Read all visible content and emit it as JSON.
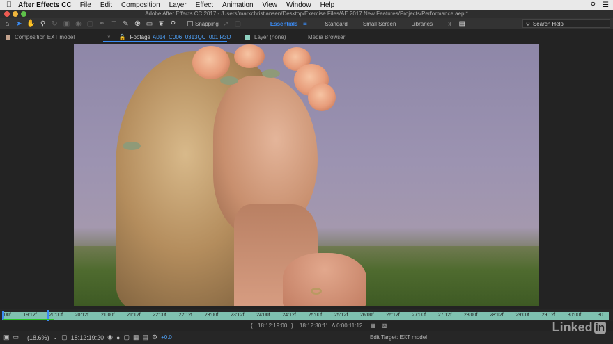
{
  "menubar": {
    "app_name": "After Effects CC",
    "items": [
      "File",
      "Edit",
      "Composition",
      "Layer",
      "Effect",
      "Animation",
      "View",
      "Window",
      "Help"
    ]
  },
  "window": {
    "title": "Adobe After Effects CC 2017 - /Users/markchristiansen/Desktop/Exercise Files/AE 2017 New Features/Projects/Performance.aep *"
  },
  "toolbar": {
    "snapping_label": "Snapping",
    "workspaces": [
      "Essentials",
      "Standard",
      "Small Screen",
      "Libraries"
    ],
    "active_workspace": "Essentials",
    "more": "»",
    "search_placeholder": "Search Help"
  },
  "panel_tabs": {
    "composition": "Composition EXT model",
    "footage_prefix": "Footage",
    "footage_file": "A014_C006_0313QU_001.R3D",
    "layer": "Layer (none)",
    "media_browser": "Media Browser"
  },
  "timeline": {
    "ticks": [
      "00f",
      "19:12f",
      "20:00f",
      "20:12f",
      "21:00f",
      "21:12f",
      "22:00f",
      "22:12f",
      "23:00f",
      "23:12f",
      "24:00f",
      "24:12f",
      "25:00f",
      "25:12f",
      "26:00f",
      "26:12f",
      "27:00f",
      "27:12f",
      "28:00f",
      "28:12f",
      "29:00f",
      "29:12f",
      "30:00f",
      "30"
    ],
    "in_point": "18:12:19:00",
    "out_point": "18:12:30:11",
    "duration": "Δ 0:00:11:12",
    "current_time": "18:12:19:20",
    "zoom": "(18.6%)",
    "exposure_offset": "+0.0",
    "edit_target": "Edit Target: EXT model"
  },
  "watermark": {
    "brand": "Linked",
    "badge": "in"
  },
  "colors": {
    "accent": "#3b8cf5",
    "ruler": "#7fc1b0",
    "work_area": "#29c729"
  }
}
